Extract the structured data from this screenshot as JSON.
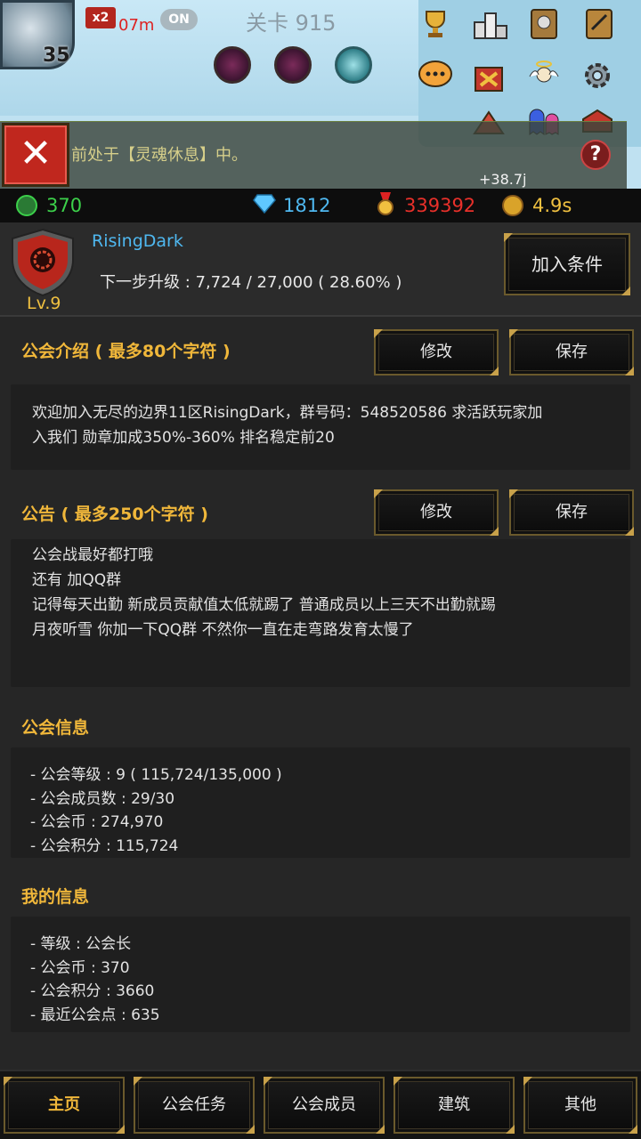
{
  "game_hud": {
    "level": "35",
    "speed_badge": "x2",
    "distance": "07m",
    "toggle": "ON",
    "stage_label": "关卡 915",
    "notice_text": "前处于【灵魂休息】中。",
    "gain_rate": "+38.7j",
    "help_symbol": "?",
    "close_symbol": "✕"
  },
  "currency_bar": {
    "guild_coins": "370",
    "diamonds": "1812",
    "medals": "339392",
    "gold_rate": "4.9s",
    "colors": {
      "guild_coins": "#3cd04a",
      "diamonds": "#4fb8f0",
      "medals": "#e8302a",
      "gold_rate": "#f0c040"
    }
  },
  "guild_header": {
    "name": "RisingDark",
    "level": "Lv.9",
    "next_level": "下一步升级 : 7,724 / 27,000 ( 28.60% )",
    "join_conditions_button": "加入条件"
  },
  "intro": {
    "title": "公会介绍 ( 最多80个字符 )",
    "edit_button": "修改",
    "save_button": "保存",
    "lines": [
      "欢迎加入无尽的边界11区RisingDark，群号码：548520586     求活跃玩家加",
      "入我们 勋章加成350%-360% 排名稳定前20"
    ]
  },
  "announcement": {
    "title": "公告 ( 最多250个字符 )",
    "edit_button": "修改",
    "save_button": "保存",
    "lines": [
      "公会战最好都打哦",
      "还有 加QQ群",
      "记得每天出勤 新成员贡献值太低就踢了 普通成员以上三天不出勤就踢",
      "月夜听雪 你加一下QQ群 不然你一直在走弯路发育太慢了"
    ]
  },
  "guild_info": {
    "title": "公会信息",
    "lines": [
      "- 公会等级 : 9  ( 115,724/135,000 )",
      "- 公会成员数 : 29/30",
      "- 公会币 : 274,970",
      "- 公会积分 : 115,724"
    ]
  },
  "my_info": {
    "title": "我的信息",
    "lines": [
      "- 等级 : 公会长",
      "- 公会币 : 370",
      "- 公会积分 : 3660",
      "- 最近公会点 : 635"
    ]
  },
  "bottom_nav": {
    "items": [
      "主页",
      "公会任务",
      "公会成员",
      "建筑",
      "其他"
    ],
    "active_index": 0
  },
  "icons": {
    "top_right": [
      "trophy-icon",
      "podium-icon",
      "book-icon",
      "quest-book-icon",
      "chat-icon",
      "shop-icon",
      "angel-icon",
      "gear-icon",
      "warning-icon",
      "ghost-icon",
      "mailbox-icon"
    ]
  }
}
